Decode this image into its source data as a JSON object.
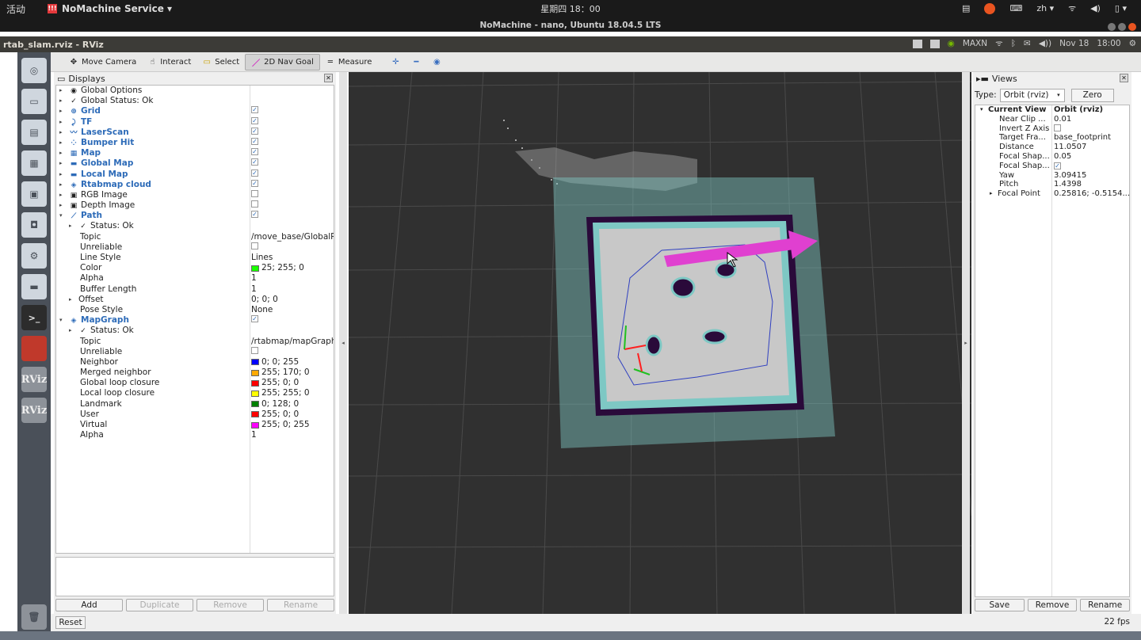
{
  "top_panel": {
    "activities": "活动",
    "nm_icon": "!!!",
    "app_menu": "NoMachine Service ▾",
    "clock": "星期四 18：00",
    "session_title": "NoMachine - nano, Ubuntu 18.04.5 LTS",
    "lang": "zh ▾"
  },
  "window": {
    "title": "rtab_slam.rviz - RViz",
    "remote_tray": {
      "power_mode": "MAXN",
      "date": "Nov 18",
      "time": "18:00"
    }
  },
  "launcher": {
    "items": [
      "chromium",
      "files",
      "writer",
      "calc",
      "impress",
      "software",
      "settings",
      "drive",
      "terminal",
      "app",
      "RViz",
      "RViz",
      "trash"
    ],
    "terminal_label": ">_",
    "rviz_label": "RViz"
  },
  "toolbar": {
    "tools": [
      {
        "label": "Move Camera",
        "icon": "move-camera-icon",
        "glyph": "✥"
      },
      {
        "label": "Interact",
        "icon": "interact-icon",
        "glyph": "☝"
      },
      {
        "label": "Select",
        "icon": "select-icon",
        "glyph": "▭"
      },
      {
        "label": "2D Nav Goal",
        "icon": "nav-goal-icon",
        "glyph": "／"
      },
      {
        "label": "Measure",
        "icon": "measure-icon",
        "glyph": "═"
      }
    ],
    "active_tool": "2D Nav Goal"
  },
  "displays": {
    "title": "Displays",
    "rows": [
      {
        "indent": 0,
        "arrow": "▸",
        "glyph": "◉",
        "name": "Global Options",
        "bold": false,
        "value": ""
      },
      {
        "indent": 0,
        "arrow": "▸",
        "glyph": "✓",
        "name": "Global Status: Ok",
        "bold": false,
        "value": ""
      },
      {
        "indent": 0,
        "arrow": "▸",
        "glyph": "⊕",
        "name": "Grid",
        "bold": true,
        "check": "✓"
      },
      {
        "indent": 0,
        "arrow": "▸",
        "glyph": "⤸",
        "name": "TF",
        "bold": true,
        "check": "✓"
      },
      {
        "indent": 0,
        "arrow": "▸",
        "glyph": "〰",
        "name": "LaserScan",
        "bold": true,
        "check": "✓"
      },
      {
        "indent": 0,
        "arrow": "▸",
        "glyph": "⁘",
        "name": "Bumper Hit",
        "bold": true,
        "check": "✓"
      },
      {
        "indent": 0,
        "arrow": "▸",
        "glyph": "▦",
        "name": "Map",
        "bold": true,
        "check": "✓"
      },
      {
        "indent": 0,
        "arrow": "▸",
        "glyph": "▬",
        "name": "Global Map",
        "bold": true,
        "check": "✓"
      },
      {
        "indent": 0,
        "arrow": "▸",
        "glyph": "▬",
        "name": "Local Map",
        "bold": true,
        "check": "✓"
      },
      {
        "indent": 0,
        "arrow": "▸",
        "glyph": "◈",
        "name": "Rtabmap cloud",
        "bold": true,
        "check": "✓"
      },
      {
        "indent": 0,
        "arrow": "▸",
        "glyph": "▣",
        "name": "RGB Image",
        "bold": false,
        "check": ""
      },
      {
        "indent": 0,
        "arrow": "▸",
        "glyph": "▣",
        "name": "Depth Image",
        "bold": false,
        "check": ""
      },
      {
        "indent": 0,
        "arrow": "▾",
        "glyph": "⟋",
        "name": "Path",
        "bold": true,
        "check": "✓"
      },
      {
        "indent": 1,
        "arrow": "▸",
        "glyph": "✓",
        "name": "Status: Ok",
        "bold": false,
        "value": ""
      },
      {
        "indent": 2,
        "name": "Topic",
        "value": "/move_base/GlobalPlanner/plan"
      },
      {
        "indent": 2,
        "name": "Unreliable",
        "check": ""
      },
      {
        "indent": 2,
        "name": "Line Style",
        "value": "Lines"
      },
      {
        "indent": 2,
        "name": "Color",
        "swatch": "#19ff00",
        "value": "25; 255; 0"
      },
      {
        "indent": 2,
        "name": "Alpha",
        "value": "1"
      },
      {
        "indent": 2,
        "name": "Buffer Length",
        "value": "1"
      },
      {
        "indent": 1,
        "arrow": "▸",
        "name": "Offset",
        "value": "0; 0; 0"
      },
      {
        "indent": 2,
        "name": "Pose Style",
        "value": "None"
      },
      {
        "indent": 0,
        "arrow": "▾",
        "glyph": "◈",
        "name": "MapGraph",
        "bold": true,
        "check": "✓"
      },
      {
        "indent": 1,
        "arrow": "▸",
        "glyph": "✓",
        "name": "Status: Ok",
        "bold": false,
        "value": ""
      },
      {
        "indent": 2,
        "name": "Topic",
        "value": "/rtabmap/mapGraph"
      },
      {
        "indent": 2,
        "name": "Unreliable",
        "check": ""
      },
      {
        "indent": 2,
        "name": "Neighbor",
        "swatch": "#0000ff",
        "value": "0; 0; 255"
      },
      {
        "indent": 2,
        "name": "Merged neighbor",
        "swatch": "#ffaa00",
        "value": "255; 170; 0"
      },
      {
        "indent": 2,
        "name": "Global loop closure",
        "swatch": "#ff0000",
        "value": "255; 0; 0"
      },
      {
        "indent": 2,
        "name": "Local loop closure",
        "swatch": "#ffff00",
        "value": "255; 255; 0"
      },
      {
        "indent": 2,
        "name": "Landmark",
        "swatch": "#008000",
        "value": "0; 128; 0"
      },
      {
        "indent": 2,
        "name": "User",
        "swatch": "#ff0000",
        "value": "255; 0; 0"
      },
      {
        "indent": 2,
        "name": "Virtual",
        "swatch": "#ff00ff",
        "value": "255; 0; 255"
      },
      {
        "indent": 2,
        "name": "Alpha",
        "value": "1"
      }
    ],
    "buttons": {
      "add": "Add",
      "duplicate": "Duplicate",
      "remove": "Remove",
      "rename": "Rename"
    }
  },
  "views": {
    "title": "Views",
    "type_label": "Type:",
    "type_value": "Orbit (rviz)",
    "zero": "Zero",
    "rows": [
      {
        "indent": 0,
        "arrow": "▾",
        "name": "Current View",
        "value": "Orbit (rviz)",
        "bold": true
      },
      {
        "indent": 1,
        "name": "Near Clip ...",
        "value": "0.01"
      },
      {
        "indent": 1,
        "name": "Invert Z Axis",
        "check": ""
      },
      {
        "indent": 1,
        "name": "Target Fra...",
        "value": "base_footprint"
      },
      {
        "indent": 1,
        "name": "Distance",
        "value": "11.0507"
      },
      {
        "indent": 1,
        "name": "Focal Shap...",
        "value": "0.05"
      },
      {
        "indent": 1,
        "name": "Focal Shap...",
        "check": "✓"
      },
      {
        "indent": 1,
        "name": "Yaw",
        "value": "3.09415"
      },
      {
        "indent": 1,
        "name": "Pitch",
        "value": "1.4398"
      },
      {
        "indent": 0,
        "arrow": "▸",
        "name": "Focal Point",
        "value": "0.25816; -0.5154...",
        "sub": true
      }
    ],
    "buttons": {
      "save": "Save",
      "remove": "Remove",
      "rename": "Rename"
    }
  },
  "bottom": {
    "reset": "Reset",
    "fps": "22 fps"
  },
  "colors": {
    "viewport_bg": "#303030",
    "grid": "#4a4a4a",
    "costmap": "#7ec8c4",
    "free_space": "#c8c8c8",
    "obstacle": "#2a0a3a",
    "nav_goal_arrow": "#e040d0",
    "path_line": "#3040c0",
    "selected_bold": "#2d6bb8"
  }
}
